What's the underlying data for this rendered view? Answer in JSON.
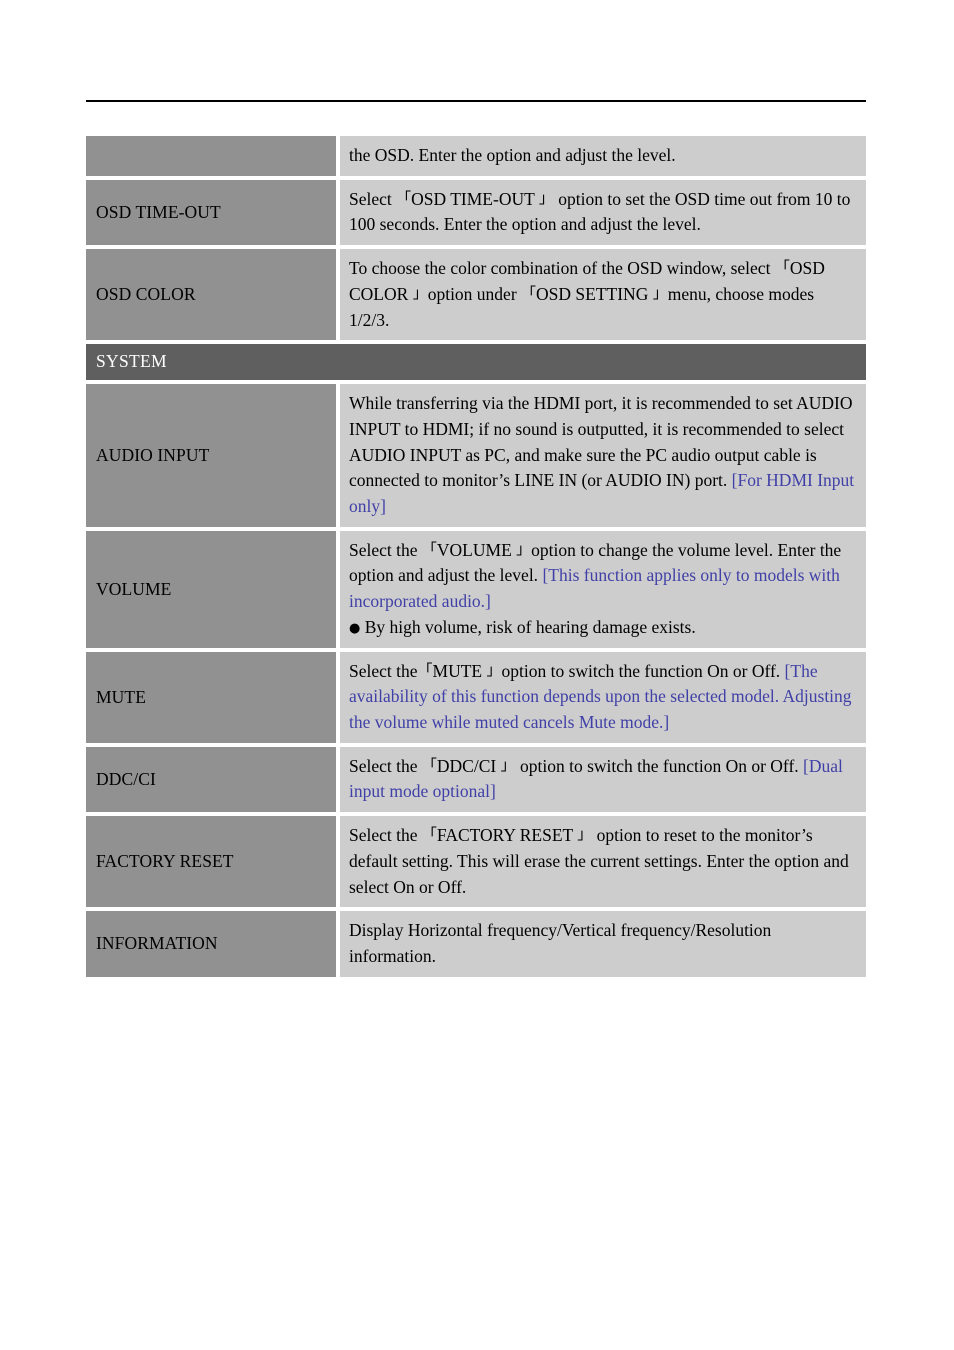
{
  "page": {
    "header_rule": true,
    "colors": {
      "label_cell_bg": "#919191",
      "desc_cell_bg": "#cdcdcd",
      "section_bg": "#5f5f5f",
      "accent_blue": "#4040a8",
      "text": "#000000",
      "section_text": "#ffffff",
      "page_bg": "#ffffff"
    }
  },
  "table": {
    "rows": [
      {
        "type": "item",
        "label": "",
        "desc_plain": "the OSD. Enter the option and adjust the level.",
        "lines": [
          {
            "segments": [
              {
                "text": "the OSD. Enter the option and adjust the level.",
                "style": "normal"
              }
            ]
          }
        ]
      },
      {
        "type": "item",
        "label": "OSD TIME-OUT",
        "desc_plain": "Select 「OSD TIME-OUT 」option to set the OSD time out from 10 to 100 seconds. Enter the option and adjust the level.",
        "lines": [
          {
            "segments": [
              {
                "text": "Select  ",
                "style": "normal"
              },
              {
                "text": "「",
                "style": "bracket"
              },
              {
                "text": "OSD TIME-OUT ",
                "style": "normal"
              },
              {
                "text": "」",
                "style": "bracket"
              },
              {
                "text": " option to set the OSD time out from 10 to 100 seconds. Enter the option and adjust the level.",
                "style": "normal"
              }
            ]
          }
        ]
      },
      {
        "type": "item",
        "label": "OSD COLOR",
        "desc_plain": "To choose the color combination of the OSD window, select 「OSD COLOR」option under 「OSD SETTING」menu, choose modes 1/2/3.",
        "lines": [
          {
            "segments": [
              {
                "text": "To choose the color combination of the OSD window, select ",
                "style": "normal"
              },
              {
                "text": "「",
                "style": "bracket"
              },
              {
                "text": "OSD COLOR ",
                "style": "normal"
              },
              {
                "text": "」",
                "style": "bracket"
              },
              {
                "text": "option under ",
                "style": "normal"
              },
              {
                "text": "「",
                "style": "bracket"
              },
              {
                "text": "OSD SETTING ",
                "style": "normal"
              },
              {
                "text": "」",
                "style": "bracket"
              },
              {
                "text": "menu, choose modes 1/2/3.",
                "style": "normal"
              }
            ]
          }
        ]
      },
      {
        "type": "section",
        "label": "SYSTEM"
      },
      {
        "type": "item",
        "label": "AUDIO INPUT",
        "desc_plain": "While transferring via the HDMI port, it is recommended to set AUDIO INPUT to HDMI; if no sound is outputted, it is recommended to select AUDIO INPUT as PC, and make sure the PC audio output cable is connected to monitor’s LINE IN (or AUDIO IN) port. [For HDMI Input only]",
        "lines": [
          {
            "segments": [
              {
                "text": "While transferring via the HDMI port, it is recommended to set AUDIO INPUT to HDMI; if no sound is outputted, it is recommended to select AUDIO INPUT as PC, and make sure the PC audio output cable is connected to monitor’s LINE IN (or AUDIO IN) port. ",
                "style": "normal"
              },
              {
                "text": "[For HDMI Input only]",
                "style": "blue"
              }
            ]
          }
        ]
      },
      {
        "type": "item",
        "label": "VOLUME",
        "desc_plain": "Select the 「VOLUME 」option to change the volume level. Enter the option and adjust the level. [This function applies only to models with incorporated audio.] ● By high volume, risk of hearing damage exists.",
        "lines": [
          {
            "segments": [
              {
                "text": "Select the ",
                "style": "normal"
              },
              {
                "text": "「",
                "style": "bracket"
              },
              {
                "text": "VOLUME ",
                "style": "normal"
              },
              {
                "text": "」",
                "style": "bracket"
              },
              {
                "text": "option to change the volume level. Enter the option and adjust the level. ",
                "style": "normal"
              },
              {
                "text": "[This function applies only to models with incorporated audio.]",
                "style": "blue"
              }
            ]
          },
          {
            "segments": [
              {
                "text": "●",
                "style": "bullet"
              },
              {
                "text": "  By high volume, risk of hearing damage exists.",
                "style": "normal"
              }
            ]
          }
        ]
      },
      {
        "type": "item",
        "label": "MUTE",
        "desc_plain": "Select the「MUTE 」option to switch the function On or Off. [The availability of this function depends upon the selected model. Adjusting the volume while muted cancels Mute mode.]",
        "lines": [
          {
            "segments": [
              {
                "text": "Select the",
                "style": "normal"
              },
              {
                "text": "「",
                "style": "bracket"
              },
              {
                "text": "MUTE ",
                "style": "normal"
              },
              {
                "text": "」",
                "style": "bracket"
              },
              {
                "text": "option to switch the function On or Off. ",
                "style": "normal"
              },
              {
                "text": "[The availability of this function depends upon the selected model. Adjusting the volume while muted cancels Mute mode.]",
                "style": "blue"
              }
            ]
          }
        ]
      },
      {
        "type": "item",
        "label": "DDC/CI",
        "desc_plain": "Select the 「DDC/CI 」option to switch the function On or Off. [Dual input mode optional]",
        "lines": [
          {
            "segments": [
              {
                "text": "Select the  ",
                "style": "normal"
              },
              {
                "text": "「",
                "style": "bracket"
              },
              {
                "text": "DDC/CI ",
                "style": "normal"
              },
              {
                "text": "」",
                "style": "bracket"
              },
              {
                "text": " option to switch the function On or Off. ",
                "style": "normal"
              },
              {
                "text": "[Dual input mode optional]",
                "style": "blue"
              }
            ]
          }
        ]
      },
      {
        "type": "item",
        "label": "FACTORY RESET",
        "desc_plain": "Select the 「FACTORY RESET 」option to reset to the monitor’s default setting. This will erase the current settings. Enter the option and select On or Off.",
        "lines": [
          {
            "segments": [
              {
                "text": "Select the  ",
                "style": "normal"
              },
              {
                "text": "「",
                "style": "bracket"
              },
              {
                "text": "FACTORY RESET ",
                "style": "normal"
              },
              {
                "text": "」",
                "style": "bracket"
              },
              {
                "text": " option to reset to the monitor’s default setting. This will erase the current settings. Enter the option and select On or Off.",
                "style": "normal"
              }
            ]
          }
        ]
      },
      {
        "type": "item",
        "label": "INFORMATION",
        "desc_plain": "Display Horizontal frequency/Vertical frequency/Resolution information.",
        "lines": [
          {
            "segments": [
              {
                "text": "Display Horizontal frequency/Vertical frequency/Resolution information.",
                "style": "normal"
              }
            ]
          }
        ]
      }
    ]
  }
}
